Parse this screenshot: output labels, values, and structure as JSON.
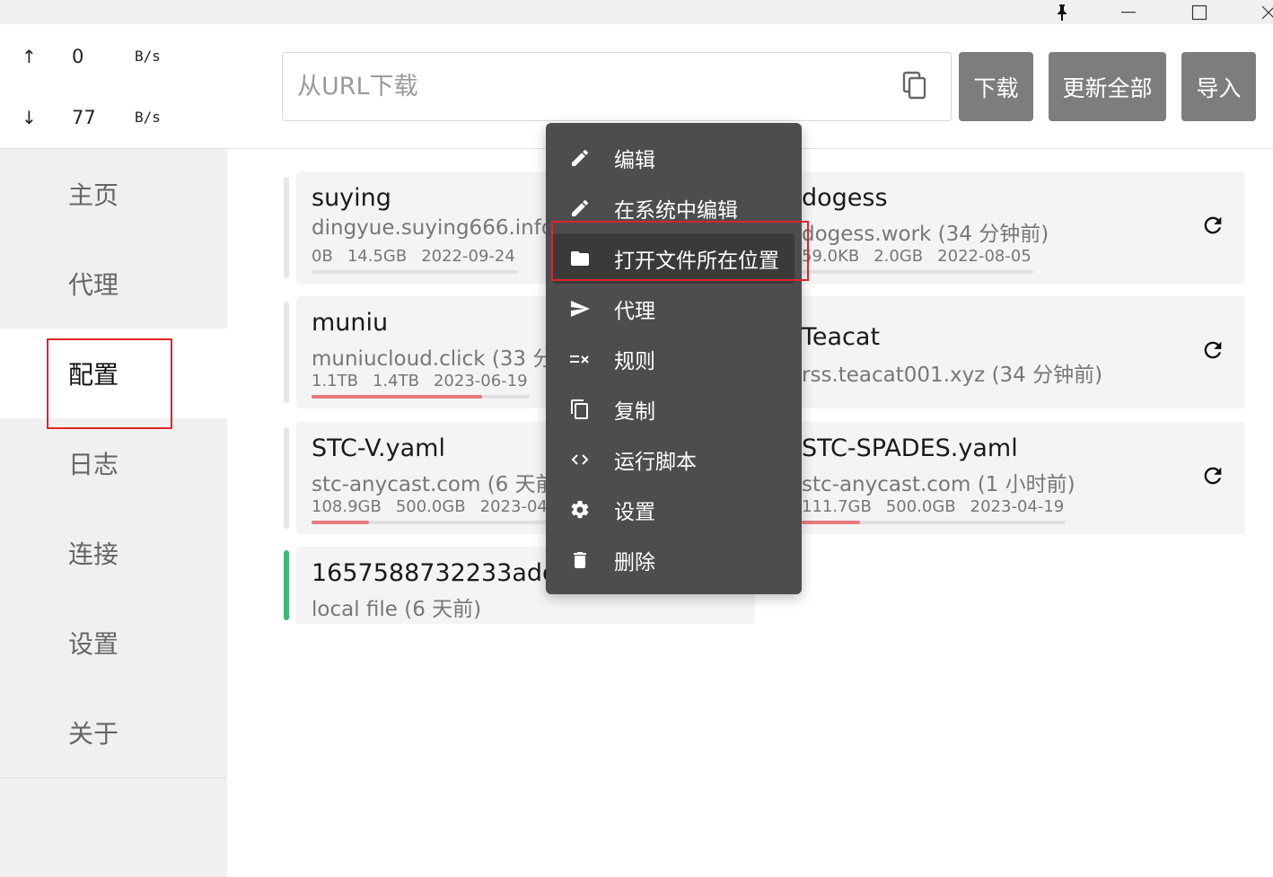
{
  "window": {
    "pin_icon": "pin-icon",
    "minimize_icon": "minimize-icon",
    "maximize_icon": "maximize-icon",
    "close_icon": "close-icon"
  },
  "traffic": {
    "upload": {
      "arrow": "↑",
      "value": "0",
      "unit": "B/s"
    },
    "download": {
      "arrow": "↓",
      "value": "77",
      "unit": "B/s"
    }
  },
  "sidebar": {
    "items": [
      {
        "label": "主页"
      },
      {
        "label": "代理"
      },
      {
        "label": "配置",
        "active": true
      },
      {
        "label": "日志"
      },
      {
        "label": "连接"
      },
      {
        "label": "设置"
      },
      {
        "label": "关于"
      }
    ]
  },
  "toolbar": {
    "url_placeholder": "从URL下载",
    "url_value": "",
    "download_label": "下载",
    "update_all_label": "更新全部",
    "import_label": "导入"
  },
  "profiles": [
    {
      "name": "suying",
      "sub": "dingyue.suying666.info",
      "used": "0B",
      "total": "14.5GB",
      "expire": "2022-09-24",
      "usage_fraction": 0.0
    },
    {
      "name": "dogess",
      "sub": "dogess.work (34 分钟前)",
      "used": "59.0KB",
      "total": "2.0GB",
      "expire": "2022-08-05",
      "usage_fraction": 0.0
    },
    {
      "name": "muniu",
      "sub": "muniucloud.click (33 分钟前)",
      "used": "1.1TB",
      "total": "1.4TB",
      "expire": "2023-06-19",
      "usage_fraction": 0.78
    },
    {
      "name": "Teacat",
      "sub": "rss.teacat001.xyz (34 分钟前)"
    },
    {
      "name": "STC-V.yaml",
      "sub": "stc-anycast.com (6 天前)",
      "used": "108.9GB",
      "total": "500.0GB",
      "expire": "2023-04-19",
      "usage_fraction": 0.22
    },
    {
      "name": "STC-SPADES.yaml",
      "sub": "stc-anycast.com (1 小时前)",
      "used": "111.7GB",
      "total": "500.0GB",
      "expire": "2023-04-19",
      "usage_fraction": 0.22
    },
    {
      "name": "1657588732233add_",
      "sub": "local file (6 天前)",
      "selected": true
    }
  ],
  "context_menu": {
    "items": [
      {
        "icon": "pencil-icon",
        "label": "编辑"
      },
      {
        "icon": "pencil-icon",
        "label": "在系统中编辑"
      },
      {
        "icon": "folder-icon",
        "label": "打开文件所在位置",
        "hover": true
      },
      {
        "icon": "send-icon",
        "label": "代理"
      },
      {
        "icon": "rule-icon",
        "label": "规则"
      },
      {
        "icon": "copy-icon",
        "label": "复制"
      },
      {
        "icon": "code-icon",
        "label": "运行脚本"
      },
      {
        "icon": "gear-icon",
        "label": "设置"
      },
      {
        "icon": "trash-icon",
        "label": "删除"
      }
    ]
  },
  "colors": {
    "highlight": "#e0242b",
    "selected_bar": "#3cb878",
    "usage_fill": "#e57980",
    "button": "#7d7d7d",
    "menu_bg": "#4d4d4d"
  }
}
